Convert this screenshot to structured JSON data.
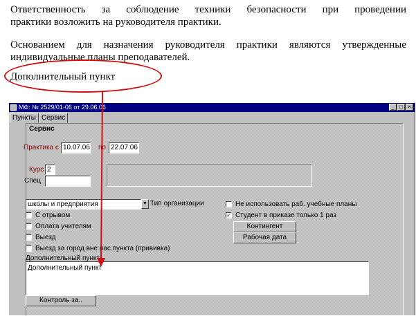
{
  "document": {
    "paragraph1_line1": "Ответственность за соблюдение техники безопасности при проведении",
    "paragraph1_line2": "практики возложить на руководителя практики.",
    "paragraph2_line1": "Основанием для назначения руководителя практики являются утвержденные",
    "paragraph2_line2": "индивидуальные планы преподавателей.",
    "highlighted_item": "Дополнительный пункт"
  },
  "annotation_color": "#d01010",
  "window": {
    "title": "МФ: № 2529/01-06 от 29.06.06",
    "tabs": [
      "Пункты",
      "Сервис"
    ],
    "active_tab": "Сервис",
    "section_title": "Сервис",
    "practice_label": "Практика с",
    "practice_from": "10.07.06",
    "practice_to_label": "по",
    "practice_to": "22.07.06",
    "course_label": "Курс",
    "course_value": "2",
    "spec_label": "Спец",
    "spec_value": "",
    "org_type_value": "школы и предприятия",
    "org_type_label": "Тип организации",
    "checkboxes_left": [
      {
        "label": "С отрывом",
        "checked": false
      },
      {
        "label": "Оплата учителям",
        "checked": false
      },
      {
        "label": "Выезд",
        "checked": false
      },
      {
        "label": "Выезд за город вне нас.пункта (прививка)",
        "checked": false
      }
    ],
    "checkboxes_right": [
      {
        "label": "Не использовать раб. учебные планы",
        "checked": false
      },
      {
        "label": "Студент в приказе только 1 раз",
        "checked": true
      }
    ],
    "contingent_button": "Контингент",
    "work_date_button": "Рабочая дата",
    "extra_item_label": "Дополнительный пункт",
    "extra_item_value": "Дополнительный пункт",
    "control_button": "Контроль за.."
  }
}
